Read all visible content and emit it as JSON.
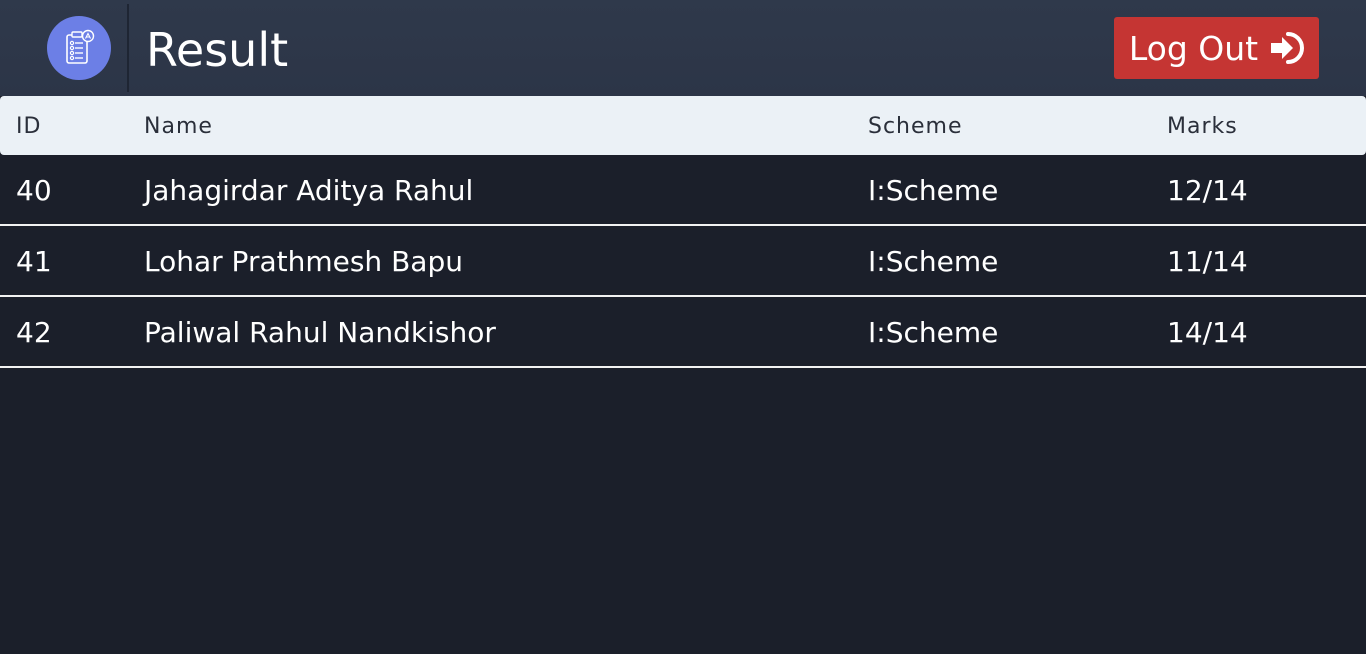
{
  "header": {
    "title": "Result",
    "logo_icon": "exam-sheet-icon",
    "logo_color": "#6c7fe6",
    "logout_label": "Log Out",
    "logout_icon": "sign-out-arrow-icon",
    "logout_color": "#c53533"
  },
  "table": {
    "columns": [
      "ID",
      "Name",
      "Scheme",
      "Marks"
    ],
    "rows": [
      {
        "id": "40",
        "name": "Jahagirdar Aditya Rahul",
        "scheme": "I:Scheme",
        "marks": "12/14"
      },
      {
        "id": "41",
        "name": "Lohar Prathmesh Bapu",
        "scheme": "I:Scheme",
        "marks": "11/14"
      },
      {
        "id": "42",
        "name": "Paliwal Rahul Nandkishor",
        "scheme": "I:Scheme",
        "marks": "14/14"
      }
    ]
  }
}
